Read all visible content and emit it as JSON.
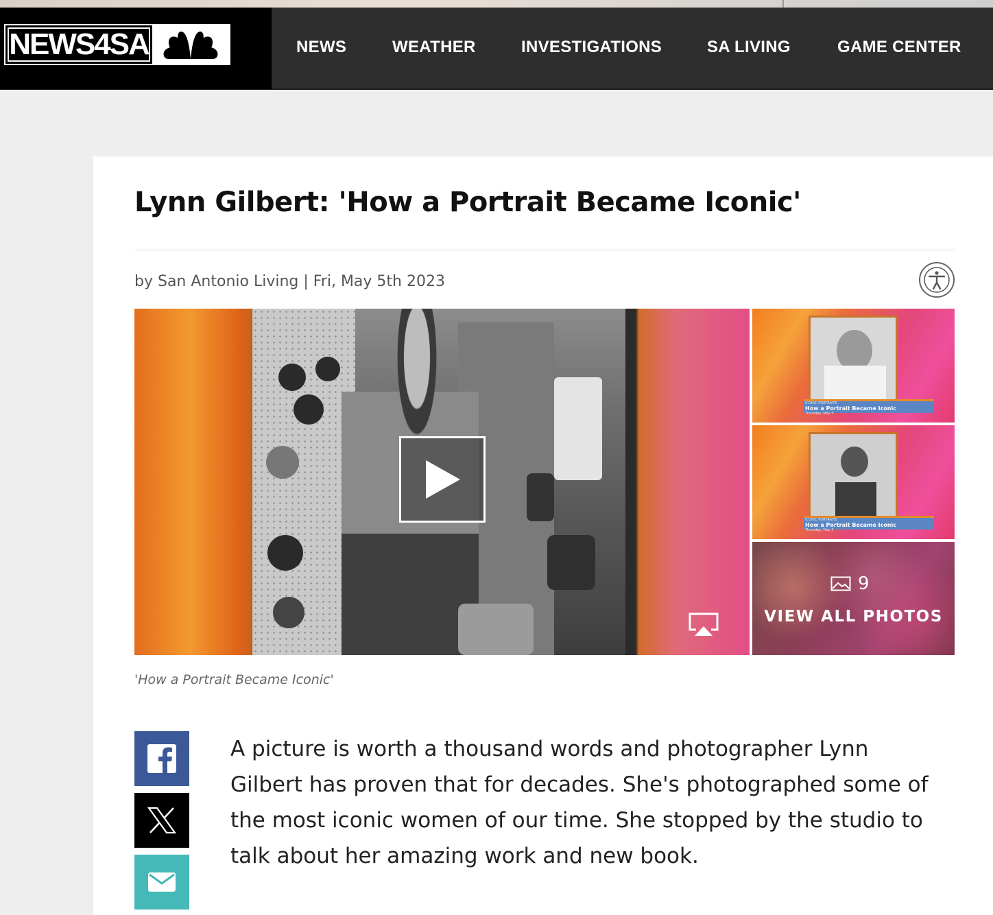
{
  "site": {
    "logo_text": "NEWS4SA"
  },
  "nav": {
    "items": [
      {
        "label": "NEWS"
      },
      {
        "label": "WEATHER"
      },
      {
        "label": "INVESTIGATIONS"
      },
      {
        "label": "SA LIVING"
      },
      {
        "label": "GAME CENTER"
      }
    ]
  },
  "article": {
    "title": "Lynn Gilbert: 'How a Portrait Became Iconic'",
    "byline": "by San Antonio Living | Fri, May 5th 2023",
    "caption": "'How a Portrait Became Iconic'",
    "body": "A picture is worth a thousand words and photographer Lynn Gilbert has proven that for decades. She's photographed some of the most iconic women of our time. She stopped by the studio to talk about her amazing work and new book."
  },
  "gallery": {
    "thumbs": [
      {
        "tag": "ICONIC PORTRAITS",
        "headline": "How a Portrait Became Iconic",
        "date": "Thursday, May 5"
      },
      {
        "tag": "ICONIC PORTRAITS",
        "headline": "How a Portrait Became Iconic",
        "date": "Thursday, May 5"
      }
    ],
    "photo_count": "9",
    "view_all_label": "VIEW ALL PHOTOS"
  },
  "colors": {
    "header_bg": "#2e2e2e",
    "facebook": "#3b5998",
    "x": "#000000",
    "email": "#45b8b8"
  },
  "icons": [
    "peacock-icon",
    "accessibility-icon",
    "play-icon",
    "airplay-icon",
    "image-icon",
    "facebook-icon",
    "x-icon",
    "email-icon"
  ]
}
